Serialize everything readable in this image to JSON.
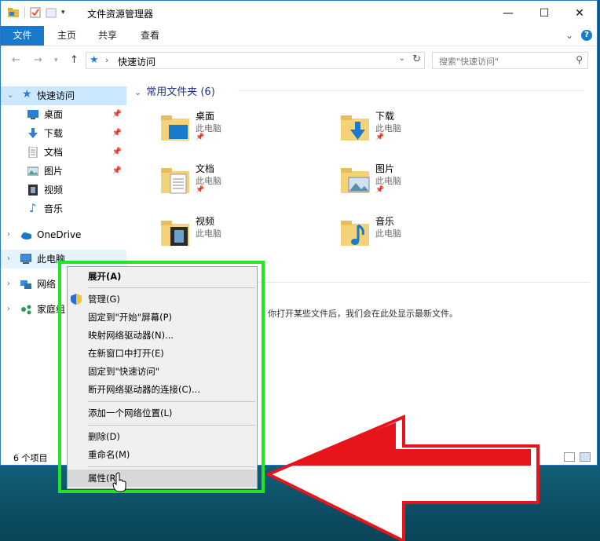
{
  "window": {
    "title": "文件资源管理器",
    "controls": {
      "minimize": "—",
      "maximize": "☐",
      "close": "✕"
    }
  },
  "ribbon": {
    "tabs": [
      "文件",
      "主页",
      "共享",
      "查看"
    ],
    "expand": "⌄",
    "help": "?"
  },
  "address": {
    "path": "快速访问",
    "search_placeholder": "搜索\"快速访问\""
  },
  "nav": {
    "quick_access": "快速访问",
    "items": [
      {
        "label": "桌面",
        "pinned": true,
        "icon": "desktop-icon"
      },
      {
        "label": "下载",
        "pinned": true,
        "icon": "download-icon"
      },
      {
        "label": "文档",
        "pinned": true,
        "icon": "document-icon"
      },
      {
        "label": "图片",
        "pinned": true,
        "icon": "picture-icon"
      },
      {
        "label": "视频",
        "pinned": false,
        "icon": "video-icon"
      },
      {
        "label": "音乐",
        "pinned": false,
        "icon": "music-icon"
      }
    ],
    "onedrive": "OneDrive",
    "this_pc": "此电脑",
    "network": "网络",
    "homegroup": "家庭组"
  },
  "content": {
    "group_title": "常用文件夹 (6)",
    "folders": [
      {
        "name": "桌面",
        "location": "此电脑",
        "pinned": true
      },
      {
        "name": "下载",
        "location": "此电脑",
        "pinned": true
      },
      {
        "name": "文档",
        "location": "此电脑",
        "pinned": true
      },
      {
        "name": "图片",
        "location": "此电脑",
        "pinned": true
      },
      {
        "name": "视频",
        "location": "此电脑",
        "pinned": false
      },
      {
        "name": "音乐",
        "location": "此电脑",
        "pinned": false
      }
    ],
    "recent_message": "你打开某些文件后，我们会在此处显示最新文件。"
  },
  "status": {
    "item_count": "6 个项目"
  },
  "context_menu": {
    "items": [
      {
        "label": "展开(A)",
        "bold": true
      },
      {
        "label": "管理(G)",
        "icon": "shield-icon"
      },
      {
        "label": "固定到\"开始\"屏幕(P)"
      },
      {
        "label": "映射网络驱动器(N)..."
      },
      {
        "label": "在新窗口中打开(E)"
      },
      {
        "label": "固定到\"快速访问\""
      },
      {
        "label": "断开网络驱动器的连接(C)..."
      },
      {
        "label": "添加一个网络位置(L)"
      },
      {
        "label": "删除(D)"
      },
      {
        "label": "重命名(M)"
      },
      {
        "label": "属性(R)",
        "hover": true
      }
    ]
  },
  "colors": {
    "accent": "#1979ca",
    "highlight_box": "#22e622",
    "annotation_arrow": "#e8141c"
  }
}
